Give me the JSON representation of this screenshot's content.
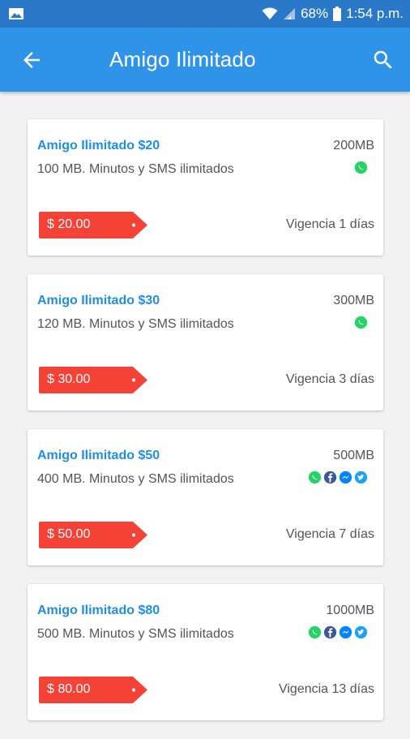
{
  "status_bar": {
    "battery": "68%",
    "time": "1:54 p.m."
  },
  "app_bar": {
    "title": "Amigo Ilimitado"
  },
  "colors": {
    "appbar": "#2f93e8",
    "statusbar": "#2a79c9",
    "title_blue": "#1f8ee6",
    "price_red": "#f44336",
    "whatsapp": "#25d366",
    "facebook": "#3b5998",
    "messenger": "#0084ff",
    "twitter": "#1da1f2"
  },
  "plans": [
    {
      "title": "Amigo Ilimitado $20",
      "description": "100 MB. Minutos y SMS ilimitados",
      "data": "200MB",
      "price": "$ 20.00",
      "validity": "Vigencia 1 días",
      "icons": [
        "whatsapp-icon"
      ]
    },
    {
      "title": "Amigo Ilimitado $30",
      "description": "120 MB. Minutos y SMS ilimitados",
      "data": "300MB",
      "price": "$ 30.00",
      "validity": "Vigencia 3 días",
      "icons": [
        "whatsapp-icon"
      ]
    },
    {
      "title": "Amigo Ilimitado $50",
      "description": "400 MB. Minutos y SMS ilimitados",
      "data": "500MB",
      "price": "$ 50.00",
      "validity": "Vigencia 7 días",
      "icons": [
        "whatsapp-icon",
        "facebook-icon",
        "messenger-icon",
        "twitter-icon"
      ]
    },
    {
      "title": "Amigo Ilimitado $80",
      "description": "500 MB. Minutos y SMS ilimitados",
      "data": "1000MB",
      "price": "$ 80.00",
      "validity": "Vigencia 13 días",
      "icons": [
        "whatsapp-icon",
        "facebook-icon",
        "messenger-icon",
        "twitter-icon"
      ]
    }
  ]
}
